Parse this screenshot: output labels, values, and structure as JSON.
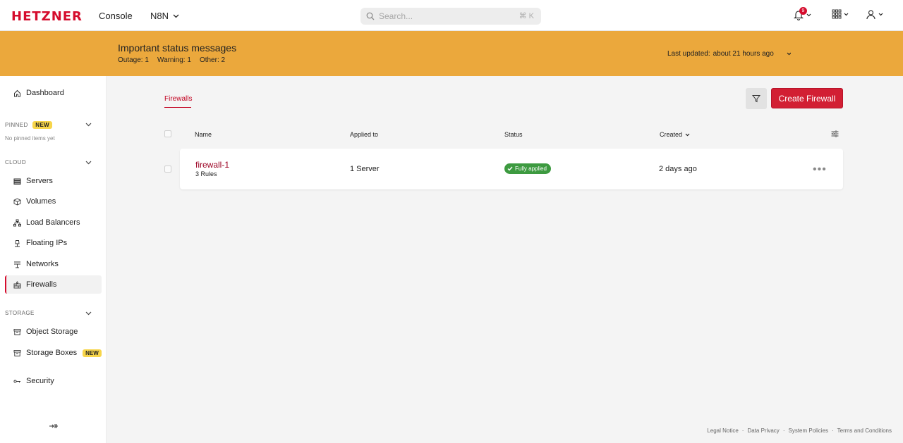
{
  "brand": {
    "logo": "HETZNER",
    "product": "Console",
    "accent": "#d50c2d"
  },
  "project": {
    "name": "N8N"
  },
  "search": {
    "placeholder": "Search...",
    "shortcut": "⌘ K"
  },
  "header": {
    "notifications_count": "9"
  },
  "status_banner": {
    "title": "Important status messages",
    "outage_label": "Outage:",
    "outage_count": "1",
    "warning_label": "Warning:",
    "warning_count": "1",
    "other_label": "Other:",
    "other_count": "2",
    "updated_label": "Last updated:",
    "updated_value": "about 21 hours ago",
    "color": "#eba83c"
  },
  "sidebar": {
    "dashboard": "Dashboard",
    "pinned": {
      "label": "PINNED",
      "tag": "NEW",
      "empty": "No pinned items yet"
    },
    "cloud": {
      "label": "CLOUD",
      "items": [
        "Servers",
        "Volumes",
        "Load Balancers",
        "Floating IPs",
        "Networks",
        "Firewalls"
      ]
    },
    "storage": {
      "label": "STORAGE",
      "items": [
        "Object Storage",
        "Storage Boxes"
      ],
      "storage_boxes_tag": "NEW"
    },
    "security": "Security",
    "active_item": "Firewalls"
  },
  "main": {
    "tab": "Firewalls",
    "create_button": "Create Firewall",
    "columns": {
      "name": "Name",
      "applied_to": "Applied to",
      "status": "Status",
      "created": "Created"
    },
    "rows": [
      {
        "name": "firewall-1",
        "rules": "3 Rules",
        "applied_to": "1 Server",
        "status": "Fully applied",
        "created": "2 days ago"
      }
    ]
  },
  "footer": {
    "links": [
      "Legal Notice",
      "Data Privacy",
      "System Policies",
      "Terms and Conditions"
    ]
  }
}
